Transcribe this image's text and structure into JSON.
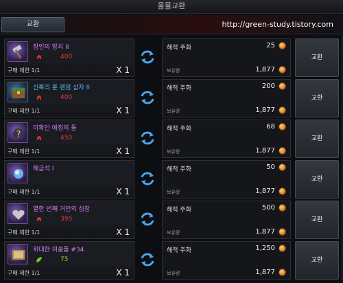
{
  "window": {
    "title": "물물교환"
  },
  "tabs": [
    {
      "label": "교환"
    }
  ],
  "watermark": "http://green-study.tistory.com",
  "common": {
    "currency_name": "해적 주화",
    "held_label": "보유량",
    "held_amount": "1,877",
    "button_label": "교환",
    "limit_label": "구매 제한 1/1",
    "qty_label": "X 1"
  },
  "items": [
    {
      "name": "장인의 망치 II",
      "name_color": "purple",
      "cost_icon": "red-helmet-icon",
      "cost": "400",
      "price": "25"
    },
    {
      "name": "신록의 룬 랜덤 상자 II",
      "name_color": "blue",
      "cost_icon": "red-helmet-icon",
      "cost": "400",
      "price": "200"
    },
    {
      "name": "미확인 애정의 돌",
      "name_color": "purple",
      "cost_icon": "red-helmet-icon",
      "cost": "450",
      "price": "68"
    },
    {
      "name": "해금석 I",
      "name_color": "purple",
      "cost_icon": "",
      "cost": "",
      "price": "50"
    },
    {
      "name": "열한 번째 거인의 심장",
      "name_color": "purple",
      "cost_icon": "red-helmet-icon",
      "cost": "395",
      "price": "500"
    },
    {
      "name": "위대한 미술품 #34",
      "name_color": "purple",
      "cost_icon": "green-leaf-icon",
      "cost": "75",
      "price": "1,250"
    }
  ],
  "colors": {
    "purple": "#d77cf5",
    "blue": "#56b8f2",
    "cost_red": "#e03b3b",
    "cost_green": "#8ed434"
  }
}
